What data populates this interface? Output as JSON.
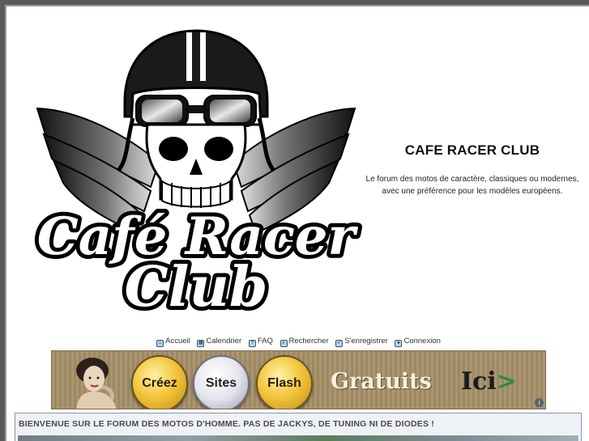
{
  "header": {
    "title": "CAFE RACER CLUB",
    "description_line1": "Le forum des motos de caractère, classiques ou modernes,",
    "description_line2": "avec une préférence pour les modèles européens.",
    "logo_line1": "Café Racer",
    "logo_line2": "Club"
  },
  "navbar": {
    "items": [
      {
        "label": "Accueil",
        "icon": "home-icon"
      },
      {
        "label": "Calendrier",
        "icon": "calendar-icon"
      },
      {
        "label": "FAQ",
        "icon": "faq-icon"
      },
      {
        "label": "Rechercher",
        "icon": "search-icon"
      },
      {
        "label": "S'enregistrer",
        "icon": "register-icon"
      },
      {
        "label": "Connexion",
        "icon": "login-icon"
      }
    ]
  },
  "banner": {
    "badge1": "Créez",
    "badge2": "Sites",
    "badge3": "Flash",
    "gratuits": "Gratuits",
    "ici": "Ici",
    "arrow": ">"
  },
  "welcome": {
    "text": "BIENVENUE SUR LE FORUM DES MOTOS D'HOMME. PAS DE JACKYS, DE TUNING NI DE DIODES !"
  },
  "colors": {
    "page_bg": "#5a5a5a",
    "content_bg": "#ffffff",
    "banner_bg": "#a58f68",
    "badge_gold": "#f3c63c",
    "ici_arrow": "#2e8b3e"
  }
}
